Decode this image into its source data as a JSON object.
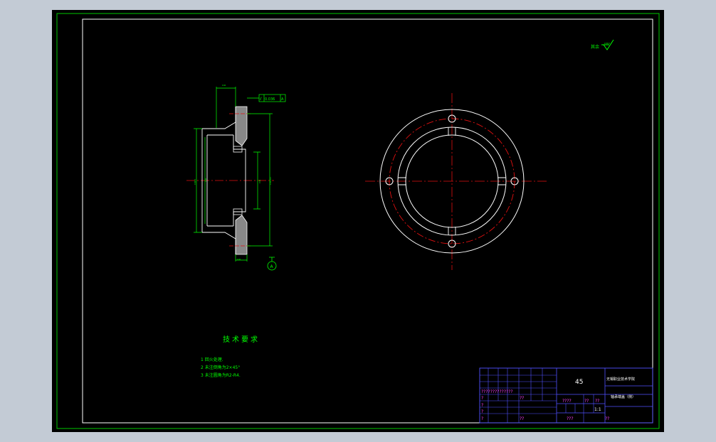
{
  "colors": {
    "background_outer": "#c3cbd5",
    "paper": "#000000",
    "frame": "#00c800",
    "line": "#ffffff",
    "center_line": "#e01010",
    "dimension": "#00ff00",
    "title_block_line": "#5050ff",
    "title_block_text": "#ff40ff"
  },
  "roughness_note": "其余",
  "technical_requirements": {
    "title": "技术要求",
    "items": [
      "1  回火处理.",
      "2  未注倒角为2×45°",
      "3  未注圆角为R2-R4."
    ]
  },
  "title_block": {
    "material": "45",
    "school": "无锡职业技术学院",
    "part_name": "轴承端盖（侧）",
    "scale": "1:1",
    "row_texts": [
      "??????????????",
      "????",
      "??",
      "??",
      "1:1"
    ],
    "placeholders": [
      "?",
      "?",
      "?",
      "?",
      "??",
      "??",
      "???",
      "??"
    ]
  },
  "datum_label": "A",
  "tolerance_frame": [
    "⫽",
    "0.036",
    "A"
  ]
}
